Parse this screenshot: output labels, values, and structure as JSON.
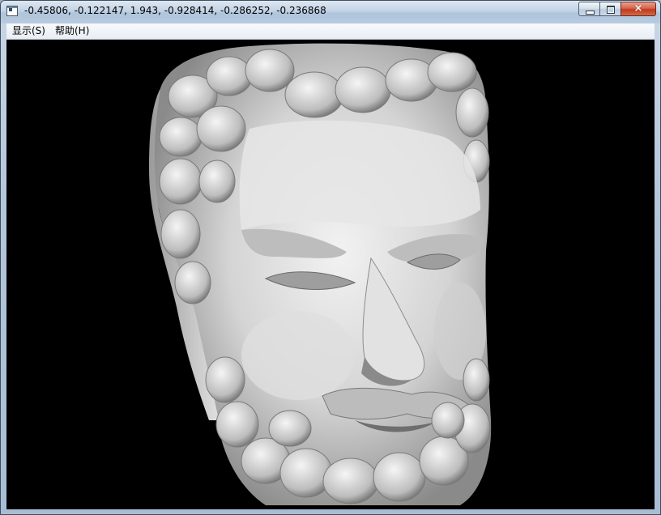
{
  "window": {
    "title": "-0.45806, -0.122147, 1.943, -0.928414, -0.286252, -0.236868",
    "icon": "app-window-icon",
    "controls": {
      "minimize": "minimize-icon",
      "maximize": "maximize-icon",
      "close": "×"
    }
  },
  "menu": {
    "items": [
      {
        "label": "显示(S)"
      },
      {
        "label": "帮助(H)"
      }
    ]
  },
  "viewport": {
    "background": "#000000",
    "content": "3d-head-sculpture-model",
    "mesh_color": "#d8d8d8"
  }
}
